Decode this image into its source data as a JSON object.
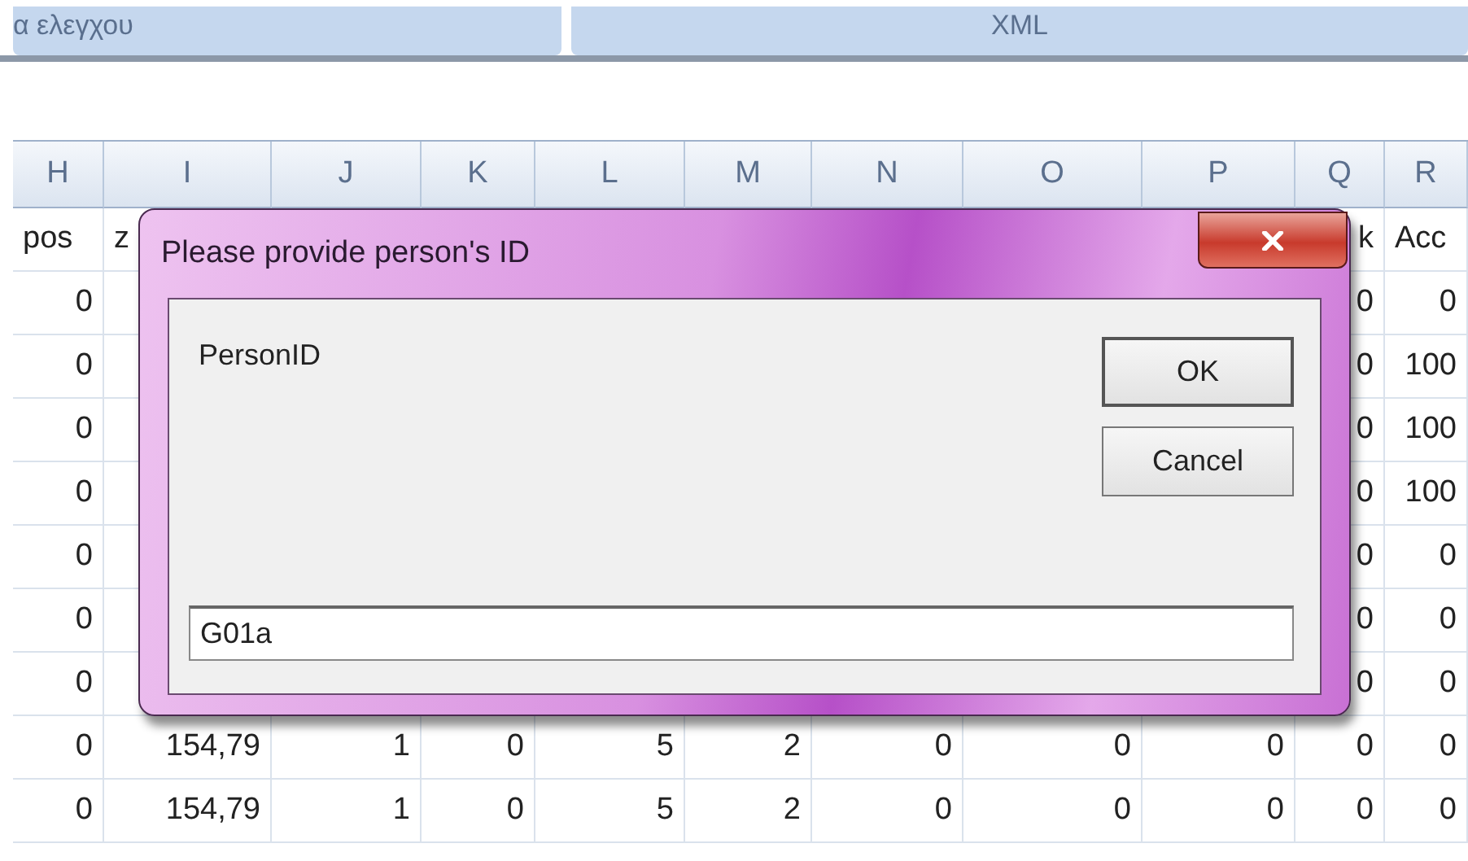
{
  "ribbon": {
    "groups": [
      "α ελεγχου",
      "XML"
    ]
  },
  "sheet": {
    "columns": [
      "H",
      "I",
      "J",
      "K",
      "L",
      "M",
      "N",
      "O",
      "P",
      "Q",
      "R"
    ],
    "rows": [
      {
        "H": "pos",
        "I": "z",
        "Q": "k",
        "R": "Acc"
      },
      {
        "H": "0",
        "Q": "0",
        "R": "0"
      },
      {
        "H": "0",
        "Q": "0",
        "R": "100"
      },
      {
        "H": "0",
        "Q": "0",
        "R": "100"
      },
      {
        "H": "0",
        "Q": "0",
        "R": "100"
      },
      {
        "H": "0",
        "Q": "0",
        "R": "0"
      },
      {
        "H": "0",
        "Q": "0",
        "R": "0"
      },
      {
        "H": "0",
        "Q": "0",
        "R": "0"
      },
      {
        "H": "0",
        "I": "154,79",
        "J": "1",
        "K": "0",
        "L": "5",
        "M": "2",
        "N": "0",
        "O": "0",
        "P": "0",
        "Q": "0",
        "R": "0"
      },
      {
        "H": "0",
        "I": "154,79",
        "J": "1",
        "K": "0",
        "L": "5",
        "M": "2",
        "N": "0",
        "O": "0",
        "P": "0",
        "Q": "0",
        "R": "0"
      }
    ]
  },
  "dialog": {
    "title": "Please provide person's ID",
    "prompt": "PersonID",
    "buttons": [
      "OK",
      "Cancel"
    ],
    "input": {
      "value": "G01a"
    }
  }
}
